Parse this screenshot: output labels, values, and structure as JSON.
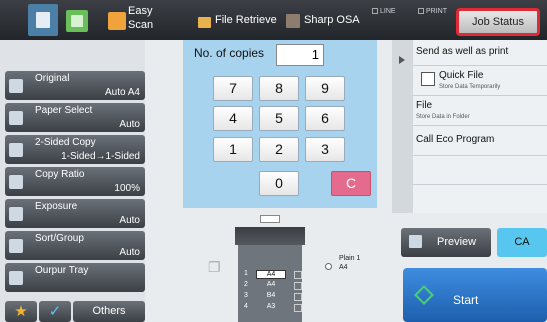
{
  "topbar": {
    "easy_scan_label": "Easy\nScan",
    "file_retrieve_label": "File Retrieve",
    "sharp_osa_label": "Sharp OSA",
    "line_label": "LINE",
    "print_label": "PRINT",
    "job_status_label": "Job Status"
  },
  "left_panel": {
    "items": [
      {
        "title": "Original",
        "value": "Auto A4",
        "icon": "original-icon"
      },
      {
        "title": "Paper Select",
        "value": "Auto",
        "icon": "paper-icon"
      },
      {
        "title": "2-Sided Copy",
        "value": "1-Sided→1-Sided",
        "icon": "duplex-icon"
      },
      {
        "title": "Copy Ratio",
        "value": "100%",
        "icon": "ratio-icon"
      },
      {
        "title": "Exposure",
        "value": "Auto",
        "icon": "exposure-icon"
      },
      {
        "title": "Sort/Group",
        "value": "Auto",
        "icon": "sort-icon"
      },
      {
        "title": "Ourpur Tray",
        "value": "",
        "icon": "tray-icon"
      }
    ],
    "others_label": "Others"
  },
  "keypad": {
    "copies_label": "No. of copies",
    "copies_value": "1",
    "keys": [
      "7",
      "8",
      "9",
      "4",
      "5",
      "6",
      "1",
      "2",
      "3",
      "0"
    ],
    "clear_label": "C"
  },
  "right_panel": {
    "send_as_well_as_print": "Send as well as print",
    "quick_file_title": "Quick File",
    "quick_file_sub": "Store Data Temporarily",
    "file_title": "File",
    "file_sub": "Store Data in Folder",
    "call_eco_program": "Call Eco Program"
  },
  "actions": {
    "preview_label": "Preview",
    "ca_label": "CA",
    "start_label": "Start"
  },
  "machine": {
    "paper_type": "Plain 1",
    "paper_size": "A4",
    "trays": [
      {
        "number": "1",
        "size": "A4",
        "selected": true
      },
      {
        "number": "2",
        "size": "A4",
        "selected": false
      },
      {
        "number": "3",
        "size": "B4",
        "selected": false
      },
      {
        "number": "4",
        "size": "A3",
        "selected": false
      }
    ]
  },
  "colors": {
    "job_status_border": "#e02a35",
    "keypad_bg": "#a8d3ef",
    "clear_key": "#e56b8e",
    "ca_button": "#57c7f0",
    "start_button": "#1d5fae"
  }
}
